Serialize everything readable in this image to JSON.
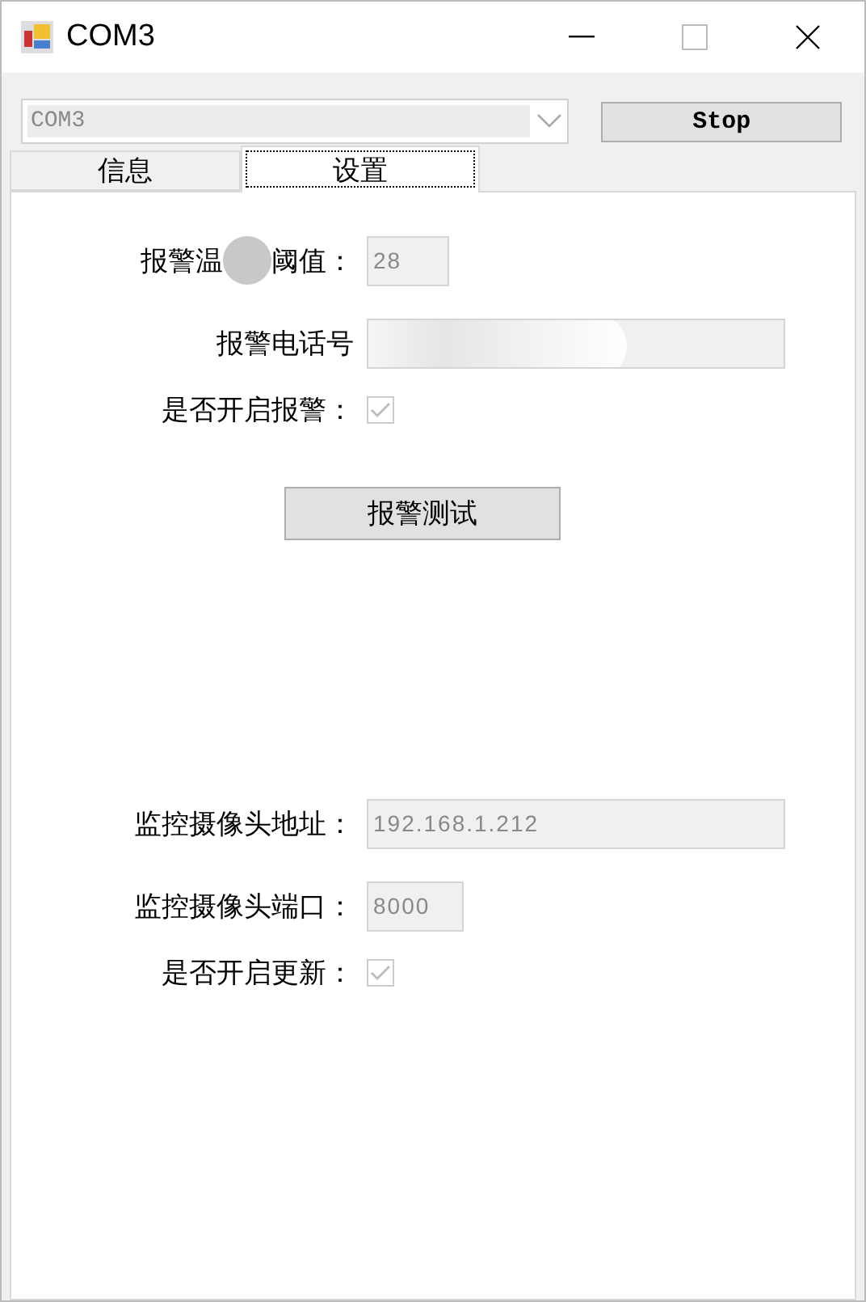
{
  "window": {
    "title": "COM3"
  },
  "port_select": {
    "value": "COM3",
    "disabled": true
  },
  "stop_button": {
    "label": "Stop"
  },
  "tabs": [
    {
      "label": "信息",
      "selected": false
    },
    {
      "label": "设置",
      "selected": true
    }
  ],
  "settings": [
    {
      "kind": "number_field",
      "label": "报警温",
      "label_after_redaction": "阈值：",
      "value": "28",
      "disabled": true
    },
    {
      "kind": "text_field",
      "label": "报警电话号",
      "value_redacted": true,
      "disabled": true
    },
    {
      "kind": "checkbox",
      "label": "是否开启报警：",
      "checked": true,
      "disabled": true
    },
    {
      "kind": "button",
      "label": "报警测试"
    },
    {
      "kind": "text_field",
      "label": "监控摄像头地址：",
      "value": "192.168.1.212",
      "disabled": true
    },
    {
      "kind": "number_field",
      "label": "监控摄像头端口：",
      "value": "8000",
      "disabled": true
    },
    {
      "kind": "checkbox",
      "label": "是否开启更新：",
      "checked": true,
      "disabled": true
    }
  ]
}
